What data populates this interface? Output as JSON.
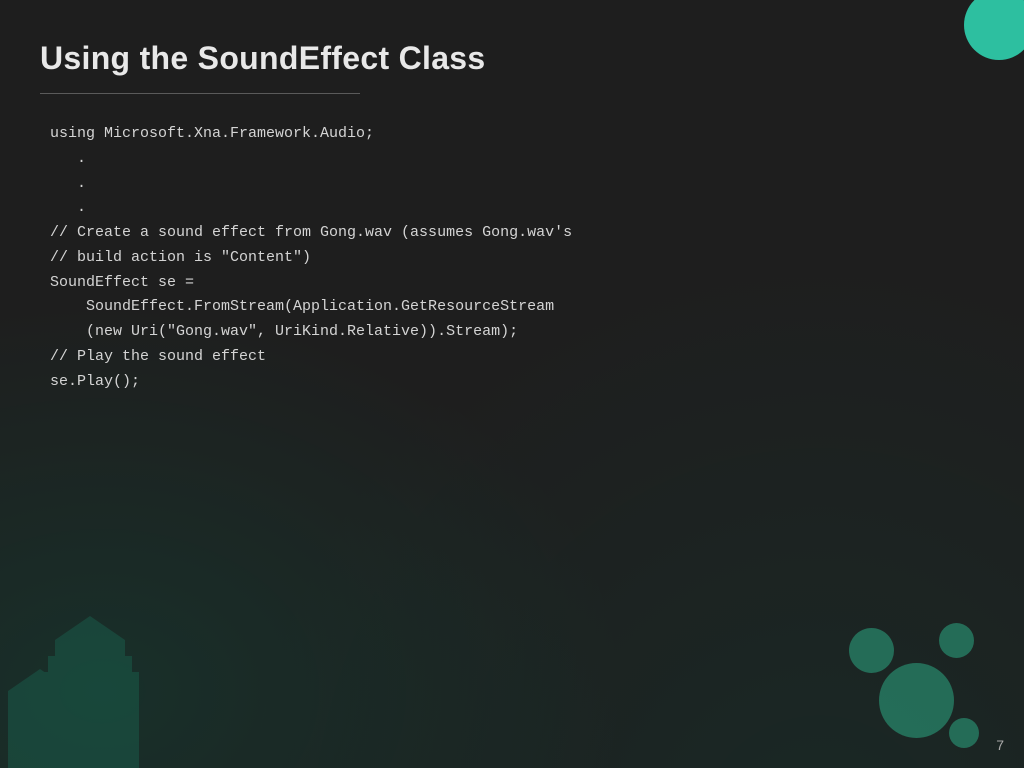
{
  "slide": {
    "title": "Using the SoundEffect Class",
    "page_number": "7",
    "code": {
      "lines": [
        "using Microsoft.Xna.Framework.Audio;",
        "   .",
        "   .",
        "   .",
        "// Create a sound effect from Gong.wav (assumes Gong.wav's",
        "// build action is \"Content\")",
        "SoundEffect se =",
        "    SoundEffect.FromStream(Application.GetResourceStream",
        "    (new Uri(\"Gong.wav\", UriKind.Relative)).Stream);",
        "",
        "// Play the sound effect",
        "se.Play();"
      ]
    },
    "decorations": {
      "top_circle_color": "#2dbfa0",
      "accent_color": "#2dbfa0"
    }
  }
}
